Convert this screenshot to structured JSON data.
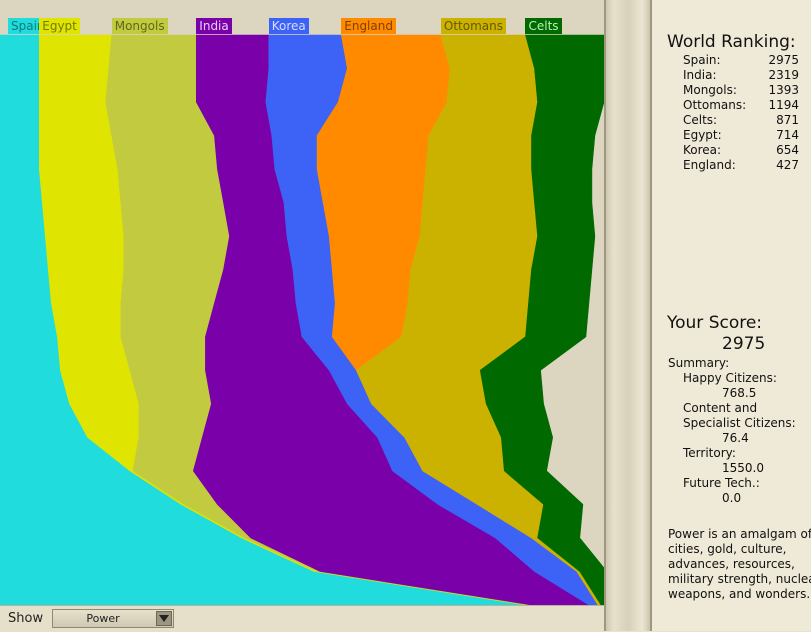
{
  "window": {
    "title": "World Ranking"
  },
  "legend": [
    {
      "name": "Spain",
      "color": "#20dcdc",
      "text_color": "#127878"
    },
    {
      "name": "Egypt",
      "color": "#dfe501",
      "text_color": "#737b00"
    },
    {
      "name": "Mongols",
      "color": "#c2cb40",
      "text_color": "#5f6816"
    },
    {
      "name": "India",
      "color": "#7a00a9",
      "text_color": "#e7d0f5"
    },
    {
      "name": "Korea",
      "color": "#3c63f5",
      "text_color": "#d5ddff"
    },
    {
      "name": "England",
      "color": "#ff8a00",
      "text_color": "#804000"
    },
    {
      "name": "Ottomans",
      "color": "#cbb200",
      "text_color": "#665900"
    },
    {
      "name": "Celts",
      "color": "#006a00",
      "text_color": "#b8f0b8"
    }
  ],
  "chart_data": {
    "type": "area",
    "stacked": "normalized-100",
    "x_direction": "top-to-bottom (time)",
    "series_order_left_to_right": [
      "Spain",
      "Egypt",
      "Mongols",
      "India",
      "Korea",
      "England",
      "Ottomans",
      "Celts"
    ],
    "x": [
      0,
      1,
      2,
      3,
      4,
      5,
      6,
      7,
      8,
      9,
      10,
      11,
      12,
      13,
      14,
      15,
      16,
      17
    ],
    "series": [
      {
        "name": "Spain",
        "values": [
          6.5,
          6.5,
          6.5,
          6.5,
          6.5,
          7.0,
          7.5,
          8.0,
          8.5,
          9.5,
          10.0,
          11.5,
          14.5,
          21.5,
          30.0,
          40.0,
          52.0,
          87.0
        ]
      },
      {
        "name": "Egypt",
        "values": [
          12.0,
          11.5,
          11.0,
          12.0,
          13.0,
          13.0,
          13.0,
          12.5,
          11.5,
          10.5,
          11.5,
          11.5,
          8.5,
          0.5,
          0.5,
          0.5,
          0.5,
          0.5
        ]
      },
      {
        "name": "Mongols",
        "values": [
          14.0,
          14.5,
          15.0,
          17.0,
          16.5,
          17.0,
          17.5,
          16.5,
          15.5,
          14.0,
          12.5,
          12.0,
          10.5,
          10.0,
          5.5,
          1.0,
          0.5,
          0.5
        ]
      },
      {
        "name": "India",
        "values": [
          12.0,
          12.0,
          11.5,
          9.5,
          9.5,
          10.0,
          9.5,
          11.5,
          13.5,
          16.0,
          20.5,
          22.5,
          29.0,
          33.0,
          36.5,
          40.5,
          35.5,
          9.5
        ]
      },
      {
        "name": "Korea",
        "values": [
          12.0,
          13.0,
          12.0,
          7.5,
          7.0,
          6.5,
          7.0,
          6.5,
          6.5,
          5.0,
          4.5,
          4.0,
          4.5,
          5.0,
          6.5,
          6.0,
          7.0,
          1.5
        ]
      },
      {
        "name": "England",
        "values": [
          16.5,
          17.0,
          18.0,
          18.5,
          18.0,
          16.5,
          15.0,
          13.0,
          12.0,
          11.5,
          0.0,
          0.0,
          0.0,
          0.0,
          0.0,
          0.0,
          0.0,
          0.0
        ]
      },
      {
        "name": "Ottomans",
        "values": [
          14.0,
          14.0,
          15.0,
          17.0,
          17.5,
          18.5,
          19.5,
          20.0,
          20.0,
          20.5,
          20.5,
          19.0,
          16.0,
          13.5,
          11.0,
          1.0,
          0.5,
          0.5
        ]
      },
      {
        "name": "Celts",
        "values": [
          13.0,
          11.5,
          11.0,
          10.5,
          10.0,
          9.5,
          9.5,
          10.0,
          10.0,
          10.0,
          10.0,
          9.5,
          8.5,
          7.0,
          6.5,
          7.0,
          4.5,
          0.5
        ]
      }
    ],
    "ylim": [
      0,
      100
    ]
  },
  "bottom_bar": {
    "show_label": "Show",
    "selected_metric": "Power"
  },
  "ranking": {
    "title": "World Ranking:",
    "rows": [
      {
        "name": "Spain:",
        "score": "2975"
      },
      {
        "name": "India:",
        "score": "2319"
      },
      {
        "name": "Mongols:",
        "score": "1393"
      },
      {
        "name": "Ottomans:",
        "score": "1194"
      },
      {
        "name": "Celts:",
        "score": "871"
      },
      {
        "name": "Egypt:",
        "score": "714"
      },
      {
        "name": "Korea:",
        "score": "654"
      },
      {
        "name": "England:",
        "score": "427"
      }
    ]
  },
  "score": {
    "title": "Your Score:",
    "value": "2975",
    "summary_label": "Summary:",
    "happy_label": "Happy Citizens:",
    "happy_value": "768.5",
    "content_label_1": "Content and",
    "content_label_2": "Specialist Citizens:",
    "content_value": "76.4",
    "territory_label": "Territory:",
    "territory_value": "1550.0",
    "future_label": "Future Tech.:",
    "future_value": "0.0"
  },
  "power_note": [
    "Power is an amalgam of",
    "cities, gold, culture,",
    "advances, resources,",
    "military strength, nuclear",
    "weapons, and wonders."
  ]
}
